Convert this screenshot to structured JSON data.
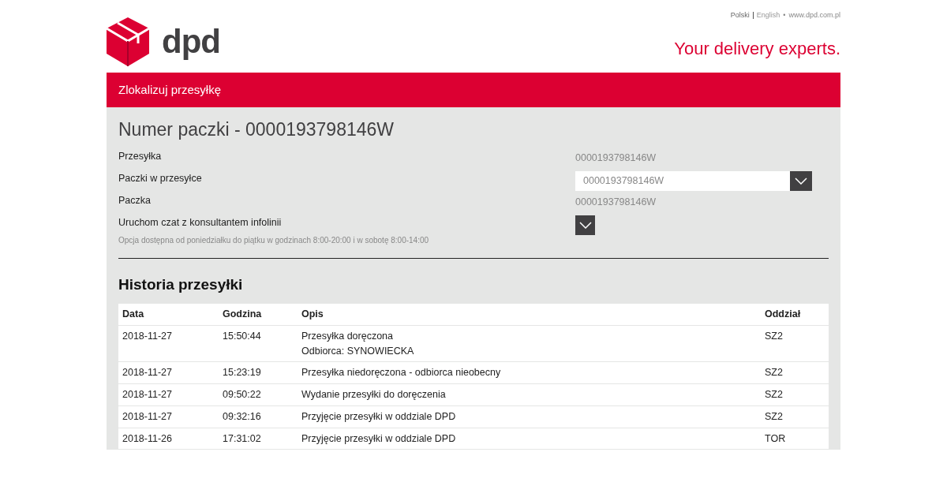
{
  "header": {
    "logo_text": "dpd",
    "languages": [
      {
        "label": "Polski",
        "selected": true
      },
      {
        "label": "English",
        "selected": false
      }
    ],
    "separator": "•",
    "site": "www.dpd.com.pl",
    "tagline": "Your delivery experts."
  },
  "title_bar": "Zlokalizuj przesyłkę",
  "heading": "Numer paczki - 0000193798146W",
  "fields": [
    {
      "kind": "text",
      "label": "Przesyłka",
      "value": "0000193798146W"
    },
    {
      "kind": "select",
      "label": "Paczki w przesyłce",
      "value": "0000193798146W"
    },
    {
      "kind": "text",
      "label": "Paczka",
      "value": "0000193798146W"
    },
    {
      "kind": "toggle",
      "label": "Uruchom czat z konsultantem infolinii",
      "note": "Opcja dostępna od poniedziałku do piątku w godzinach 8:00-20:00 i w sobotę 8:00-14:00"
    }
  ],
  "history": {
    "title": "Historia przesyłki",
    "columns": [
      "Data",
      "Godzina",
      "Opis",
      "Oddział"
    ],
    "rows": [
      {
        "date": "2018-11-27",
        "time": "15:50:44",
        "description": [
          "Przesyłka doręczona",
          "Odbiorca: SYNOWIECKA"
        ],
        "branch": "SZ2"
      },
      {
        "date": "2018-11-27",
        "time": "15:23:19",
        "description": [
          "Przesyłka niedoręczona - odbiorca nieobecny"
        ],
        "branch": "SZ2"
      },
      {
        "date": "2018-11-27",
        "time": "09:50:22",
        "description": [
          "Wydanie przesyłki do doręczenia"
        ],
        "branch": "SZ2"
      },
      {
        "date": "2018-11-27",
        "time": "09:32:16",
        "description": [
          "Przyjęcie przesyłki w oddziale DPD"
        ],
        "branch": "SZ2"
      },
      {
        "date": "2018-11-26",
        "time": "17:31:02",
        "description": [
          "Przyjęcie przesyłki w oddziale DPD"
        ],
        "branch": "TOR"
      }
    ]
  }
}
